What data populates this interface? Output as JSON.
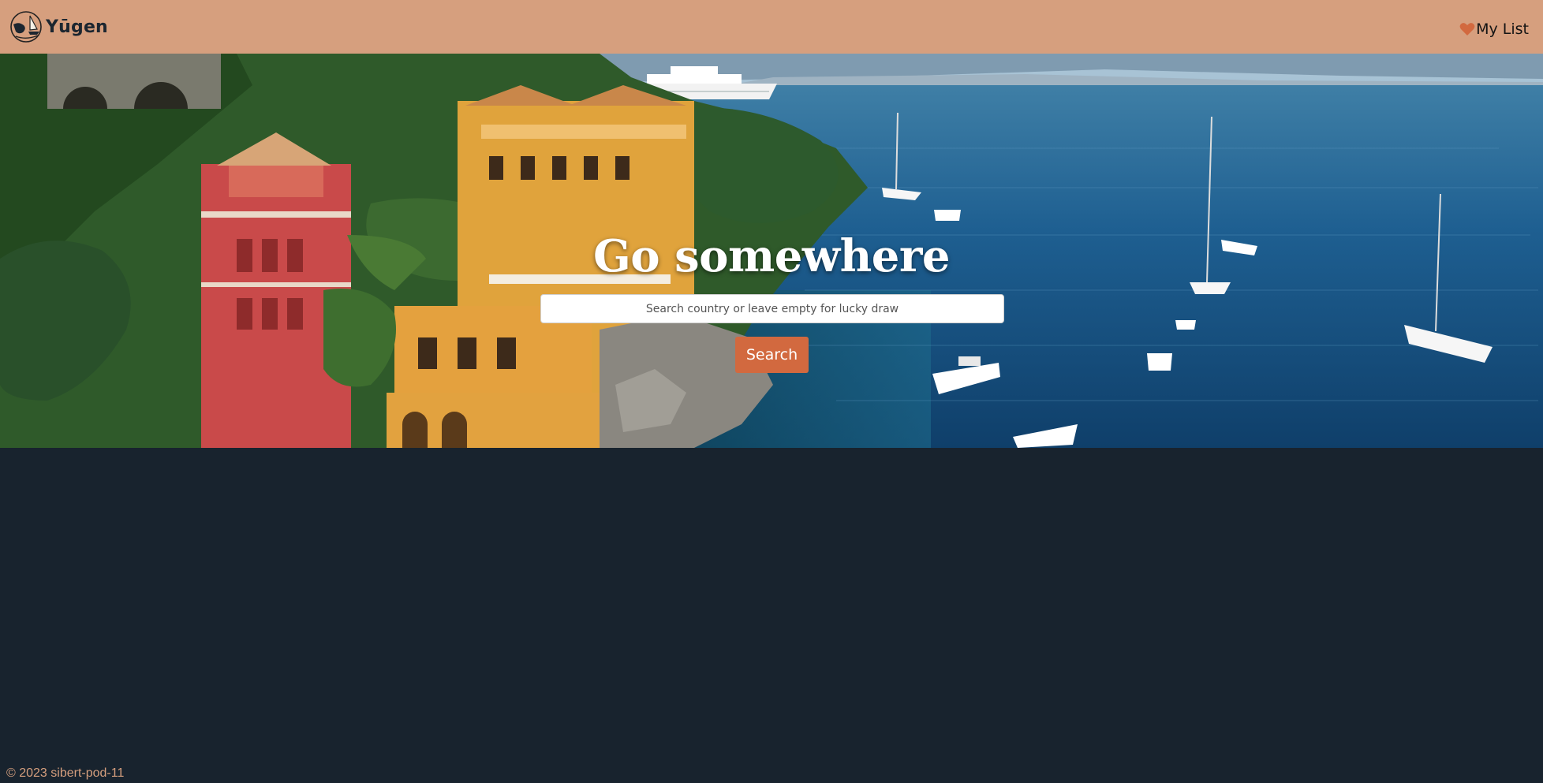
{
  "navbar": {
    "brand": "Yūgen",
    "my_list_label": "My List"
  },
  "hero": {
    "title": "Go somewhere",
    "search_placeholder": "Search country or leave empty for lucky draw",
    "search_button_label": "Search"
  },
  "footer": {
    "copyright": "© 2023 sibert-pod-11"
  },
  "colors": {
    "navbar_bg": "#d69f7e",
    "page_bg": "#18232e",
    "accent": "#d2693f",
    "heart": "#d2693f"
  },
  "icons": {
    "logo": "globe-sailboat-logo-icon",
    "my_list": "heart-icon"
  }
}
